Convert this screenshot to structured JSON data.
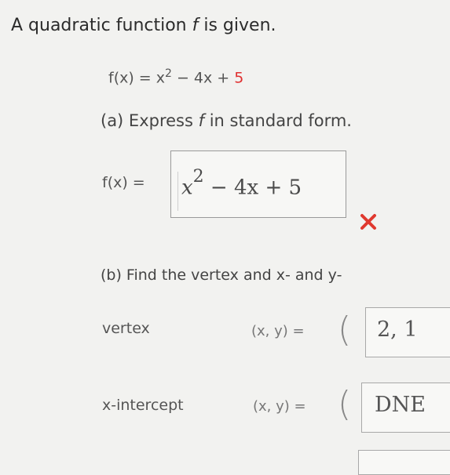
{
  "problem": {
    "title_prefix": "A quadratic function ",
    "title_f": "f",
    "title_suffix": " is given.",
    "given_lhs": "f(x) = x",
    "given_exp": "2",
    "given_mid": " − 4x + ",
    "given_const": "5"
  },
  "part_a": {
    "prompt_prefix": "(a) Express ",
    "prompt_f": "f",
    "prompt_suffix": " in standard form.",
    "fx_label": "f(x) =",
    "answer_base": "x",
    "answer_exp": "2",
    "answer_rest": " − 4x + 5",
    "status_icon": "incorrect-x-icon",
    "status_color": "#e0392f"
  },
  "part_b": {
    "prompt": "(b) Find the vertex and x- and y-",
    "vertex_label": "vertex",
    "vertex_xy": "(x, y) =",
    "vertex_paren": "(",
    "vertex_value": "2, 1",
    "xint_label": "x-intercept",
    "xint_xy": "(x, y) =",
    "xint_paren": "(",
    "xint_value": "DNE"
  }
}
